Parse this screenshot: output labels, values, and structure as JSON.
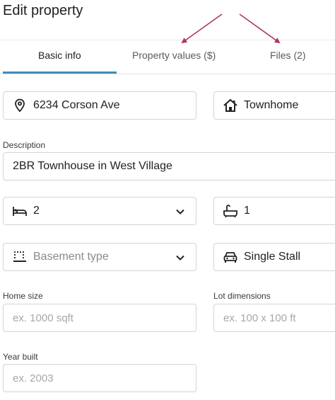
{
  "header": {
    "title": "Edit property"
  },
  "tabs": [
    {
      "label": "Basic info"
    },
    {
      "label": "Property values ($)"
    },
    {
      "label": "Files (2)"
    }
  ],
  "fields": {
    "address": {
      "value": "6234 Corson Ave",
      "icon": "location-pin-icon"
    },
    "property_type": {
      "value": "Townhome",
      "icon": "house-icon"
    },
    "description": {
      "label": "Description",
      "value": "2BR Townhouse in West Village"
    },
    "bedrooms": {
      "value": "2",
      "icon": "bed-icon"
    },
    "bathrooms": {
      "value": "1",
      "icon": "bathtub-icon"
    },
    "basement": {
      "placeholder": "Basement type",
      "icon": "basement-grid-icon"
    },
    "parking": {
      "value": "Single Stall",
      "icon": "car-icon"
    },
    "home_size": {
      "label": "Home size",
      "placeholder": "ex. 1000 sqft"
    },
    "lot_dimensions": {
      "label": "Lot dimensions",
      "placeholder": "ex. 100 x 100 ft"
    },
    "year_built": {
      "label": "Year built",
      "placeholder": "ex. 2003"
    }
  },
  "colors": {
    "tab_accent": "#3d8fb9",
    "annotation_arrow": "#b0365a"
  }
}
